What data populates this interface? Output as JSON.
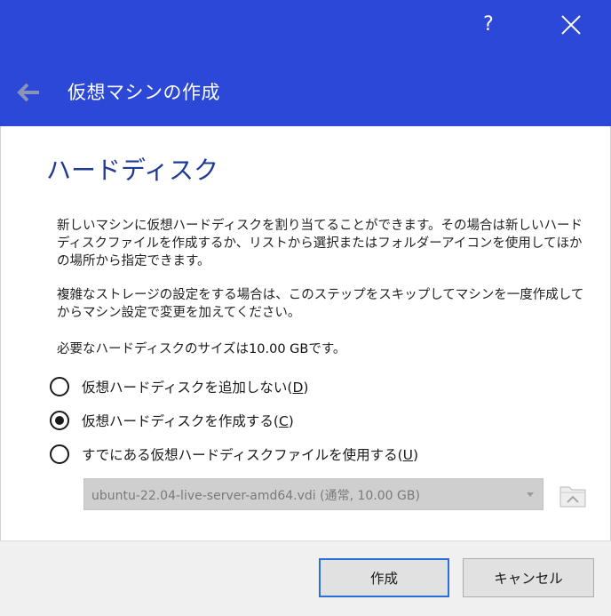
{
  "window": {
    "help_label": "?",
    "title": "仮想マシンの作成"
  },
  "page": {
    "heading": "ハードディスク",
    "para1": "新しいマシンに仮想ハードディスクを割り当てることができます。その場合は新しいハードディスクファイルを作成するか、リストから選択またはフォルダーアイコンを使用してほかの場所から指定できます。",
    "para2": "複雑なストレージの設定をする場合は、このステップをスキップしてマシンを一度作成してからマシン設定で変更を加えてください。",
    "size_prefix": "必要なハードディスクのサイズは",
    "size_value": "10.00 GB",
    "size_suffix": "です。"
  },
  "options": [
    {
      "label": "仮想ハードディスクを追加しない(",
      "accel": "D",
      "tail": ")",
      "checked": false
    },
    {
      "label": "仮想ハードディスクを作成する(",
      "accel": "C",
      "tail": ")",
      "checked": true
    },
    {
      "label": "すでにある仮想ハードディスクファイルを使用する(",
      "accel": "U",
      "tail": ")",
      "checked": false
    }
  ],
  "disk_select": {
    "value": "ubuntu-22.04-live-server-amd64.vdi (通常, 10.00 GB)",
    "enabled": false
  },
  "buttons": {
    "create": "作成",
    "cancel": "キャンセル"
  },
  "colors": {
    "titlebar": "#2b48d6",
    "heading": "#1f3a93",
    "focus_border": "#2a6fd6"
  },
  "icons": {
    "help": "question-mark-icon",
    "close": "close-icon",
    "back": "back-arrow-icon",
    "dropdown": "chevron-down-icon",
    "folder": "folder-icon"
  }
}
